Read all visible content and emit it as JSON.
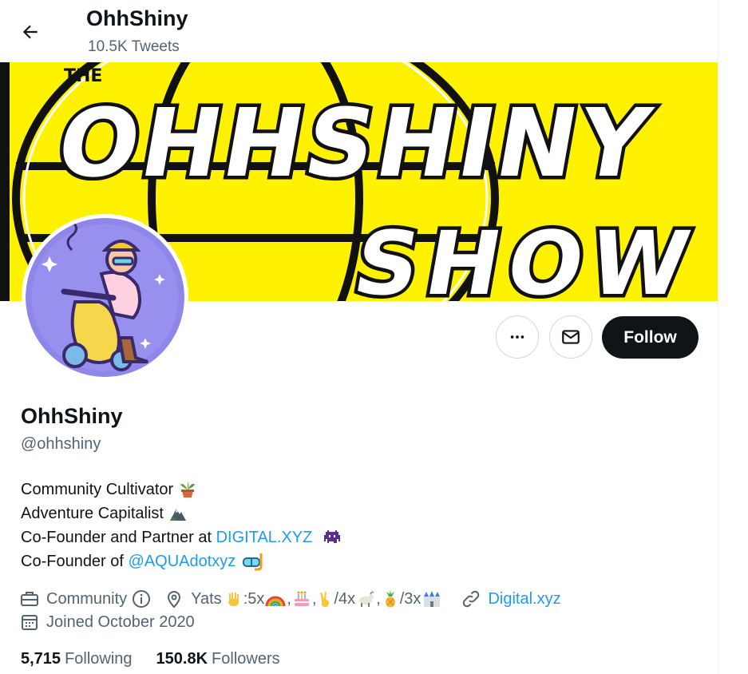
{
  "header": {
    "title": "OhhShiny",
    "tweet_count": "10.5K Tweets"
  },
  "banner": {
    "text_top": "THE",
    "text_main": "OHHSHINY",
    "text_sub": "SHOW",
    "background_color": "#fff200"
  },
  "actions": {
    "follow_label": "Follow",
    "more_icon": "more-dots-icon",
    "message_icon": "envelope-icon"
  },
  "profile": {
    "name": "OhhShiny",
    "handle": "@ohhshiny"
  },
  "bio": {
    "line1": "Community Cultivator",
    "line2": "Adventure Capitalist",
    "line3_prefix": "Co-Founder and Partner at ",
    "line3_link": "DIGITAL.XYZ",
    "line4_prefix": "Co-Founder of ",
    "line4_link": "@AQUAdotxyz"
  },
  "meta": {
    "category": "Community",
    "location_prefix": "Yats",
    "location_part1": ":5x",
    "location_sep1": ",",
    "location_sep2": ",",
    "location_part2": "/4x",
    "location_sep3": ",",
    "location_part3": "/3x",
    "website": "Digital.xyz",
    "joined": "Joined October 2020"
  },
  "stats": {
    "following_count": "5,715",
    "following_label": "Following",
    "followers_count": "150.8K",
    "followers_label": "Followers"
  },
  "colors": {
    "accent": "#1d9bf0",
    "text": "#0f1419",
    "muted": "#536471",
    "button_dark": "#0f1419"
  }
}
